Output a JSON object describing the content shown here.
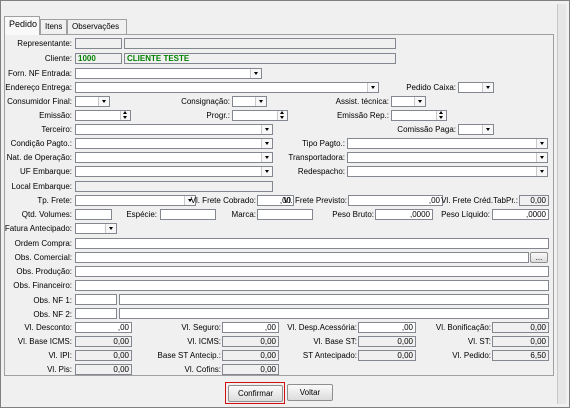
{
  "tabs": {
    "pedido": "Pedido",
    "itens": "Itens",
    "observacoes": "Observações"
  },
  "labels": {
    "representante": "Representante:",
    "cliente": "Cliente:",
    "forn_nf_entrada": "Forn. NF Entrada:",
    "endereco_entrega": "Endereço Entrega:",
    "pedido_caixa": "Pedido Caixa:",
    "consumidor_final": "Consumidor Final:",
    "consignacao": "Consignação:",
    "assist_tecnica": "Assist. técnica:",
    "emissao": "Emissão:",
    "progr": "Progr.:",
    "emissao_rep": "Emissão Rep.:",
    "terceiro": "Terceiro:",
    "comissao_paga": "Comissão Paga:",
    "condicao_pagto": "Condição Pagto.:",
    "tipo_pagto": "Tipo Pagto.:",
    "nat_operacao": "Nat. de Operação:",
    "transportadora": "Transportadora:",
    "uf_embarque": "UF Embarque:",
    "redespacho": "Redespacho:",
    "local_embarque": "Local Embarque:",
    "tp_frete": "Tp. Frete:",
    "vl_frete_cobrado": "Vl. Frete Cobrado:",
    "vl_frete_previsto": "Vl. Frete Previsto:",
    "vl_frete_cred": "Vl. Frete Créd.TabPr.:",
    "qtd_volumes": "Qtd. Volumes:",
    "especie": "Espécie:",
    "marca": "Marca:",
    "peso_bruto": "Peso Bruto:",
    "peso_liquido": "Peso Líquido:",
    "fatura_antecipado": "Fatura Antecipado:",
    "ordem_compra": "Ordem Compra:",
    "obs_comercial": "Obs. Comercial:",
    "obs_producao": "Obs. Produção:",
    "obs_financeiro": "Obs. Financeiro:",
    "obs_nf1": "Obs. NF 1:",
    "obs_nf2": "Obs. NF 2:",
    "vl_desconto": "Vl. Desconto:",
    "vl_seguro": "Vl. Seguro:",
    "vl_desp_acessoria": "Vl. Desp.Acessória:",
    "vl_bonificacao": "Vl. Bonificação:",
    "vl_base_icms": "Vl. Base ICMS:",
    "vl_icms": "Vl. ICMS:",
    "vl_base_st": "Vl. Base ST:",
    "vl_st": "Vl. ST:",
    "vl_ipi": "Vl. IPI:",
    "base_st_antecip": "Base ST Antecip.:",
    "st_antecipado": "ST Antecipado:",
    "vl_pedido": "Vl. Pedido:",
    "vl_pis": "Vl. Pis:",
    "vl_cofins": "Vl. Cofins:"
  },
  "values": {
    "cliente_codigo": "1000",
    "cliente_nome": "CLIENTE TESTE",
    "vl_frete_cobrado": ",00",
    "vl_frete_previsto": ",00",
    "vl_frete_cred": "0,00",
    "peso_bruto": ",0000",
    "peso_liquido": ",0000",
    "obs_comercial_button": "...",
    "vl_desconto": ",00",
    "vl_seguro": ",00",
    "vl_desp_acessoria": ",00",
    "vl_bonificacao": "0,00",
    "vl_base_icms": "0,00",
    "vl_icms": "0,00",
    "vl_base_st": "0,00",
    "vl_st": "0,00",
    "vl_ipi": "0,00",
    "base_st_antecip": "0,00",
    "st_antecipado": "0,00",
    "vl_pedido": "6,50",
    "vl_pis": "0,00",
    "vl_cofins": "0,00"
  },
  "buttons": {
    "confirmar": "Confirmar",
    "voltar": "Voltar"
  },
  "colors": {
    "cliente_text": "#008000",
    "confirm_border": "#d01010"
  }
}
